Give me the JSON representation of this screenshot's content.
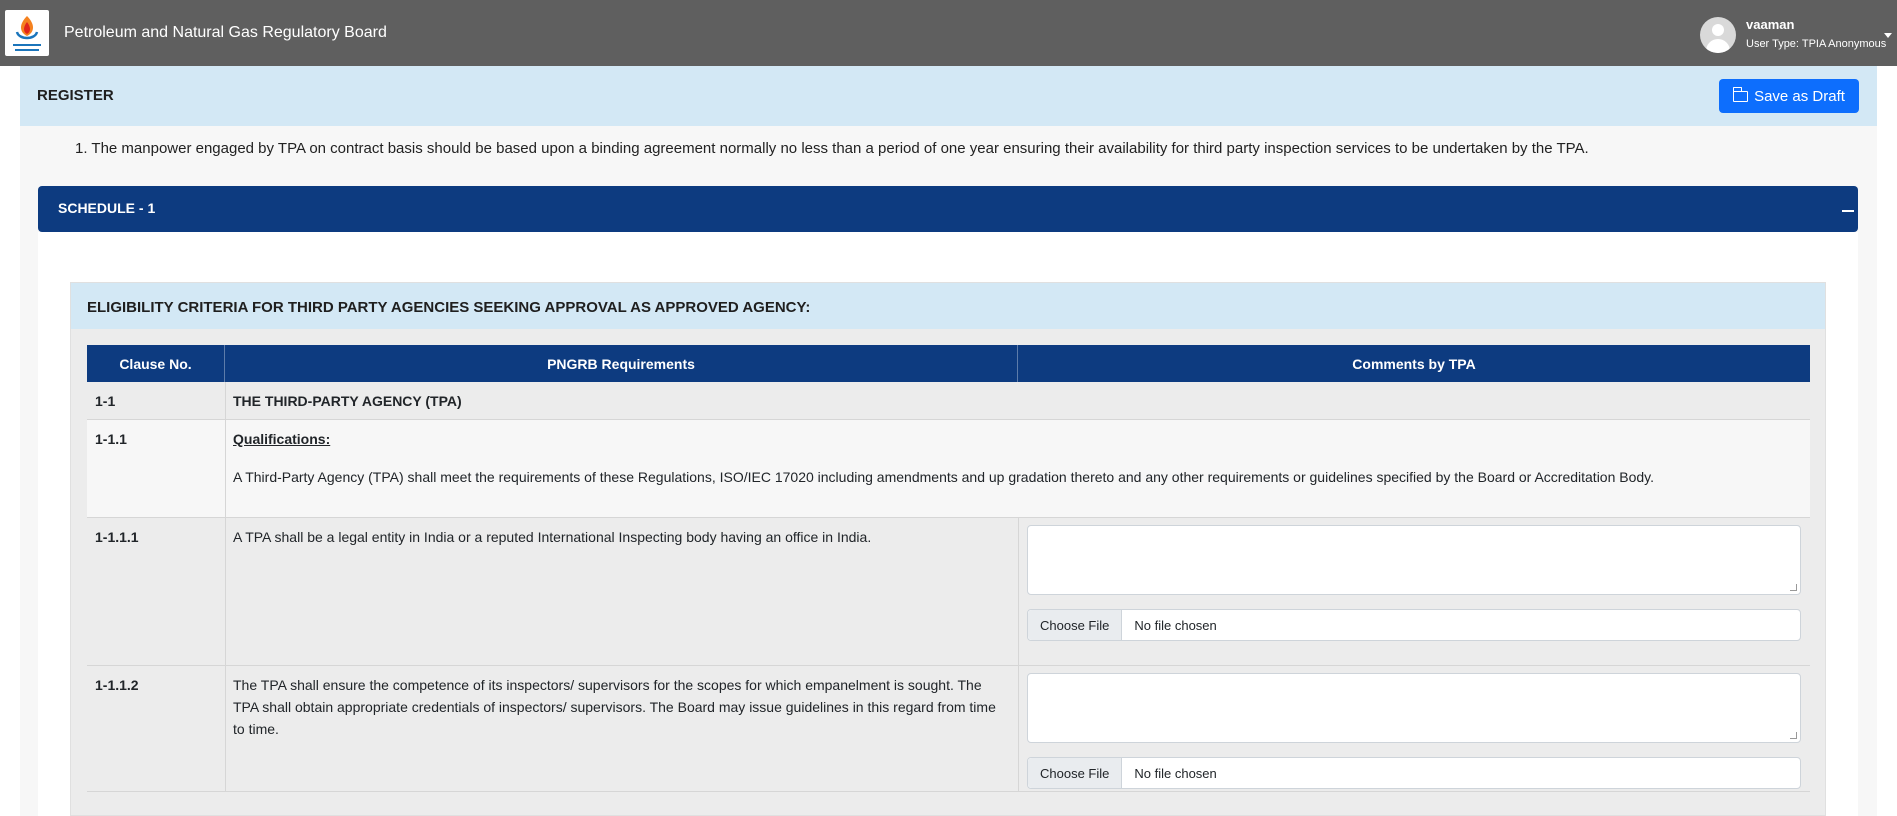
{
  "header": {
    "app_title": "Petroleum and Natural Gas Regulatory Board",
    "user_name": "vaaman",
    "user_type": "User Type: TPIA Anonymous"
  },
  "register": {
    "title": "REGISTER",
    "save_label": "Save as Draft"
  },
  "note": "1. The manpower engaged by TPA on contract basis should be based upon a binding agreement normally no less than a period of one year ensuring their availability for third party inspection services to be undertaken by the TPA.",
  "schedule": {
    "title": "SCHEDULE - 1",
    "criteria_title": "ELIGIBILITY CRITERIA FOR THIRD PARTY AGENCIES SEEKING APPROVAL AS APPROVED AGENCY:",
    "columns": [
      "Clause No.",
      "PNGRB Requirements",
      "Comments by TPA"
    ],
    "rows": [
      {
        "clause": "1-1",
        "text": "THE THIRD-PARTY AGENCY (TPA)"
      },
      {
        "clause": "1-1.1",
        "heading": "Qualifications:",
        "text": "A Third-Party Agency (TPA) shall meet the requirements of these Regulations, ISO/IEC 17020 including amendments and up gradation thereto and any other requirements or guidelines specified by the Board or Accreditation Body."
      },
      {
        "clause": "1-1.1.1",
        "text": "A TPA shall be a legal entity in India or a reputed International Inspecting body having an office in India.",
        "file_button": "Choose File",
        "file_status": "No file chosen"
      },
      {
        "clause": "1-1.1.2",
        "text": "The TPA shall ensure the competence of its inspectors/ supervisors for the scopes for which empanelment is sought. The TPA shall obtain appropriate credentials of inspectors/ supervisors. The Board may issue guidelines in this regard from time to time.",
        "file_button": "Choose File",
        "file_status": "No file chosen"
      }
    ]
  },
  "colors": {
    "topbar": "#5f5f5f",
    "accent_blue": "#0d6efd",
    "dark_blue": "#0d3b80",
    "light_blue": "#d3e8f5"
  }
}
